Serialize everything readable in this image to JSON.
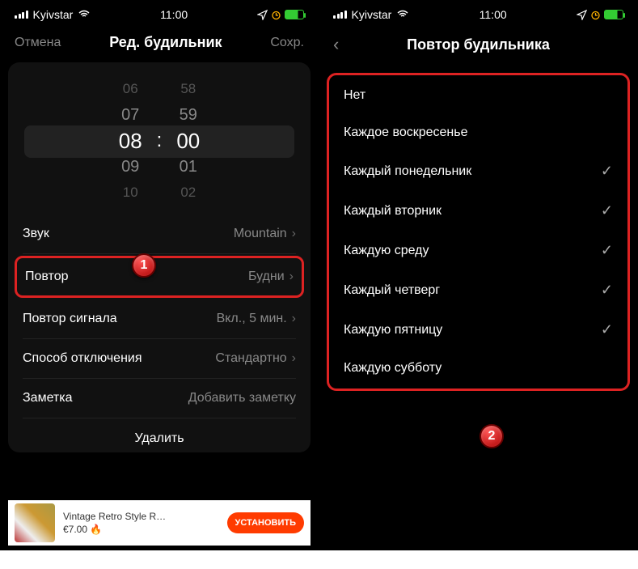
{
  "status": {
    "carrier": "Kyivstar",
    "time": "11:00"
  },
  "left": {
    "nav": {
      "cancel": "Отмена",
      "title": "Ред. будильник",
      "save": "Сохр."
    },
    "picker": {
      "hours": [
        "06",
        "07",
        "08",
        "09",
        "10"
      ],
      "minutes": [
        "58",
        "59",
        "00",
        "01",
        "02"
      ]
    },
    "rows": {
      "sound": {
        "label": "Звук",
        "value": "Mountain"
      },
      "repeat": {
        "label": "Повтор",
        "value": "Будни"
      },
      "snooze": {
        "label": "Повтор сигнала",
        "value": "Вкл., 5 мин."
      },
      "dismiss": {
        "label": "Способ отключения",
        "value": "Стандартно"
      },
      "note": {
        "label": "Заметка",
        "placeholder": "Добавить заметку"
      }
    },
    "delete": "Удалить",
    "ad": {
      "title": "Vintage Retro Style R…",
      "price": "€7.00 🔥",
      "cta": "УСТАНОВИТЬ"
    }
  },
  "right": {
    "title": "Повтор будильника",
    "options": [
      {
        "label": "Нет",
        "checked": false
      },
      {
        "label": "Каждое воскресенье",
        "checked": false
      },
      {
        "label": "Каждый понедельник",
        "checked": true
      },
      {
        "label": "Каждый вторник",
        "checked": true
      },
      {
        "label": "Каждую среду",
        "checked": true
      },
      {
        "label": "Каждый четверг",
        "checked": true
      },
      {
        "label": "Каждую пятницу",
        "checked": true
      },
      {
        "label": "Каждую субботу",
        "checked": false
      }
    ]
  },
  "badges": {
    "one": "1",
    "two": "2"
  }
}
